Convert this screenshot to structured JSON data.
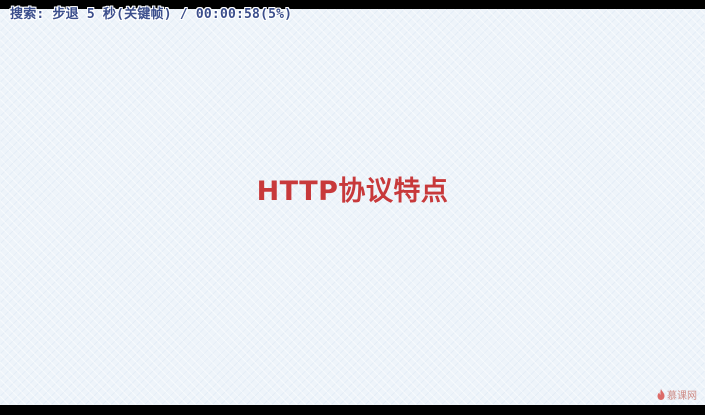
{
  "player": {
    "osd_text": "搜索: 步退 5 秒(关键帧) / 00:00:58(5%)",
    "progress_percent": 5
  },
  "slide": {
    "title": "HTTP协议特点"
  },
  "watermark": {
    "text": "慕课网",
    "icon": "flame-logo-icon"
  },
  "colors": {
    "title": "#c8393b",
    "osd_text": "#3b4e8c",
    "slide_background": "#eef4fa",
    "letterbox": "#000000",
    "watermark": "#c97a72"
  }
}
